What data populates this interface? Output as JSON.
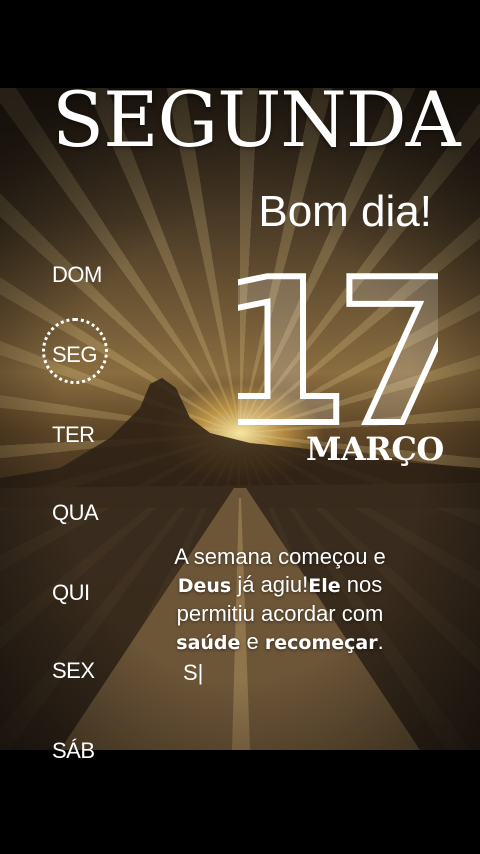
{
  "header": {
    "weekday": "SEGUNDA",
    "greeting": "Bom dia!"
  },
  "weekdays": [
    {
      "label": "DOM",
      "selected": false
    },
    {
      "label": "SEG",
      "selected": true
    },
    {
      "label": "TER",
      "selected": false
    },
    {
      "label": "QUA",
      "selected": false
    },
    {
      "label": "QUI",
      "selected": false
    },
    {
      "label": "SEX",
      "selected": false
    },
    {
      "label": "SÁB",
      "selected": false
    }
  ],
  "date": {
    "day": "17",
    "month": "MARÇO"
  },
  "message": {
    "line1": "A semana começou e",
    "line2_bold1": "Deus",
    "line2_text": " já agiu!",
    "line2_bold2": "Ele",
    "line2_end": " nos",
    "line3": "permitiu acordar com",
    "line4_bold1": "saúde",
    "line4_mid": " e ",
    "line4_bold2": "recomeçar",
    "line4_end": ".",
    "typing": "S|"
  },
  "colors": {
    "text": "#ffffff",
    "background": "#000000",
    "sun": "#ffe9a8"
  }
}
